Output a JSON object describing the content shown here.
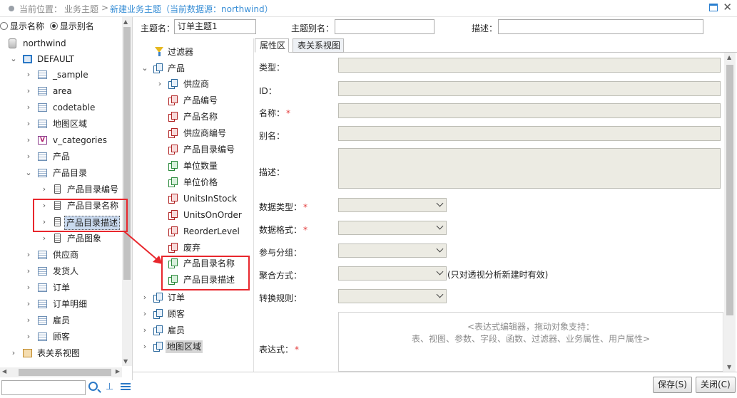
{
  "titlebar": {
    "location_label": "当前位置：",
    "crumb_1": "业务主题",
    "separator": ">",
    "crumb_2": "新建业务主题（当前数据源：northwind）",
    "maximize_icon": "maximize-icon",
    "close_icon": "close-icon",
    "close_glyph": "✕"
  },
  "left_panel": {
    "radio_options": [
      {
        "label": "显示名称",
        "checked": false
      },
      {
        "label": "显示别名",
        "checked": true
      }
    ],
    "tree": {
      "root": "northwind",
      "schema": "DEFAULT",
      "items": [
        {
          "label": "_sample",
          "type": "table"
        },
        {
          "label": "area",
          "type": "table"
        },
        {
          "label": "codetable",
          "type": "table"
        },
        {
          "label": "地图区域",
          "type": "table"
        },
        {
          "label": "v_categories",
          "type": "view"
        },
        {
          "label": "产品",
          "type": "table"
        },
        {
          "label": "产品目录",
          "type": "table",
          "expanded": true
        },
        {
          "label": "产品目录编号",
          "type": "column"
        },
        {
          "label": "产品目录名称",
          "type": "column"
        },
        {
          "label": "产品目录描述",
          "type": "column",
          "selected": true
        },
        {
          "label": "产品图象",
          "type": "column"
        },
        {
          "label": "供应商",
          "type": "table"
        },
        {
          "label": "发货人",
          "type": "table"
        },
        {
          "label": "订单",
          "type": "table"
        },
        {
          "label": "订单明细",
          "type": "table"
        },
        {
          "label": "雇员",
          "type": "table"
        },
        {
          "label": "顾客",
          "type": "table"
        },
        {
          "label": "表关系视图",
          "type": "relation"
        }
      ]
    },
    "search_placeholder": "",
    "toolbar_icons": [
      "search-icon",
      "hierarchy-icon",
      "list-icon"
    ]
  },
  "form": {
    "topic_name_label": "主题名：",
    "topic_name_value": "订单主题1",
    "topic_alias_label": "主题别名：",
    "topic_alias_value": "",
    "desc_label": "描述：",
    "desc_value": ""
  },
  "topic_tree": {
    "filter": "过滤器",
    "product": "产品",
    "supplier": "供应商",
    "fields": [
      {
        "label": "产品编号",
        "color": "red"
      },
      {
        "label": "产品名称",
        "color": "red"
      },
      {
        "label": "供应商编号",
        "color": "red"
      },
      {
        "label": "产品目录编号",
        "color": "red"
      },
      {
        "label": "单位数量",
        "color": "green"
      },
      {
        "label": "单位价格",
        "color": "green"
      },
      {
        "label": "UnitsInStock",
        "color": "red"
      },
      {
        "label": "UnitsOnOrder",
        "color": "red"
      },
      {
        "label": "ReorderLevel",
        "color": "red"
      },
      {
        "label": "废弃",
        "color": "red"
      },
      {
        "label": "产品目录名称",
        "color": "green"
      },
      {
        "label": "产品目录描述",
        "color": "green"
      }
    ],
    "others": [
      "订单",
      "顾客",
      "雇员",
      "地图区域"
    ]
  },
  "tabs": [
    "属性区",
    "表关系视图"
  ],
  "properties": {
    "type_label": "类型：",
    "id_label": "ID：",
    "name_label": "名称：",
    "alias_label": "别名：",
    "desc_label": "描述：",
    "data_type_label": "数据类型：",
    "data_format_label": "数据格式：",
    "grouping_label": "参与分组：",
    "aggregation_label": "聚合方式：",
    "aggregation_note": "(只对透视分析新建时有效)",
    "transform_label": "转换规则：",
    "expression_label": "表达式：",
    "required_mark": "*",
    "expression_hint_1": "<表达式编辑器，拖动对象支持：",
    "expression_hint_2": "表、视图、参数、字段、函数、过滤器、业务属性、用户属性>"
  },
  "footer": {
    "save_label": "保存(S)",
    "close_label": "关闭(C)"
  },
  "colors": {
    "accent": "#3a8fd6",
    "highlight": "#e8272d",
    "readonly_field": "#ecebe3"
  }
}
